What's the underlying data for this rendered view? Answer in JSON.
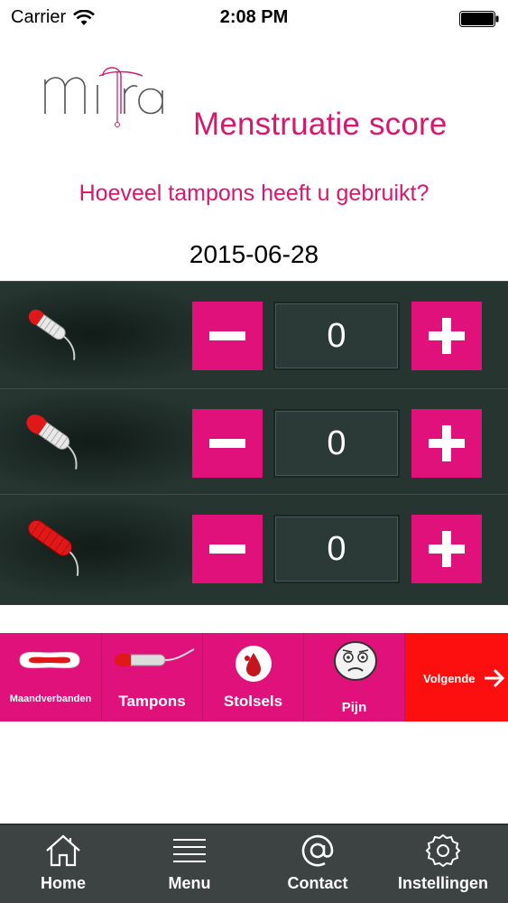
{
  "status_bar": {
    "carrier": "Carrier",
    "time": "2:08 PM"
  },
  "header": {
    "logo_text": "mira",
    "title": "Menstruatie score"
  },
  "question": "Hoeveel tampons heeft u gebruikt?",
  "date": "2015-06-28",
  "counters": [
    {
      "icon": "tampon-small-icon",
      "value": "0"
    },
    {
      "icon": "tampon-medium-icon",
      "value": "0"
    },
    {
      "icon": "tampon-large-icon",
      "value": "0"
    }
  ],
  "categories": [
    {
      "label": "Maandverbanden",
      "icon": "pad-icon"
    },
    {
      "label": "Tampons",
      "icon": "tampon-icon"
    },
    {
      "label": "Stolsels",
      "icon": "blood-drop-icon"
    },
    {
      "label": "Pijn",
      "icon": "pain-face-icon"
    }
  ],
  "next": {
    "label": "Volgende",
    "icon": "arrow-right-icon"
  },
  "nav": [
    {
      "label": "Home",
      "icon": "home-icon"
    },
    {
      "label": "Menu",
      "icon": "menu-icon"
    },
    {
      "label": "Contact",
      "icon": "at-sign-icon"
    },
    {
      "label": "Instellingen",
      "icon": "gear-icon"
    }
  ],
  "colors": {
    "accent": "#e0117a",
    "title": "#d6186e",
    "panel": "#263530",
    "next": "#fe0f0f",
    "navbar": "#3d4242"
  }
}
